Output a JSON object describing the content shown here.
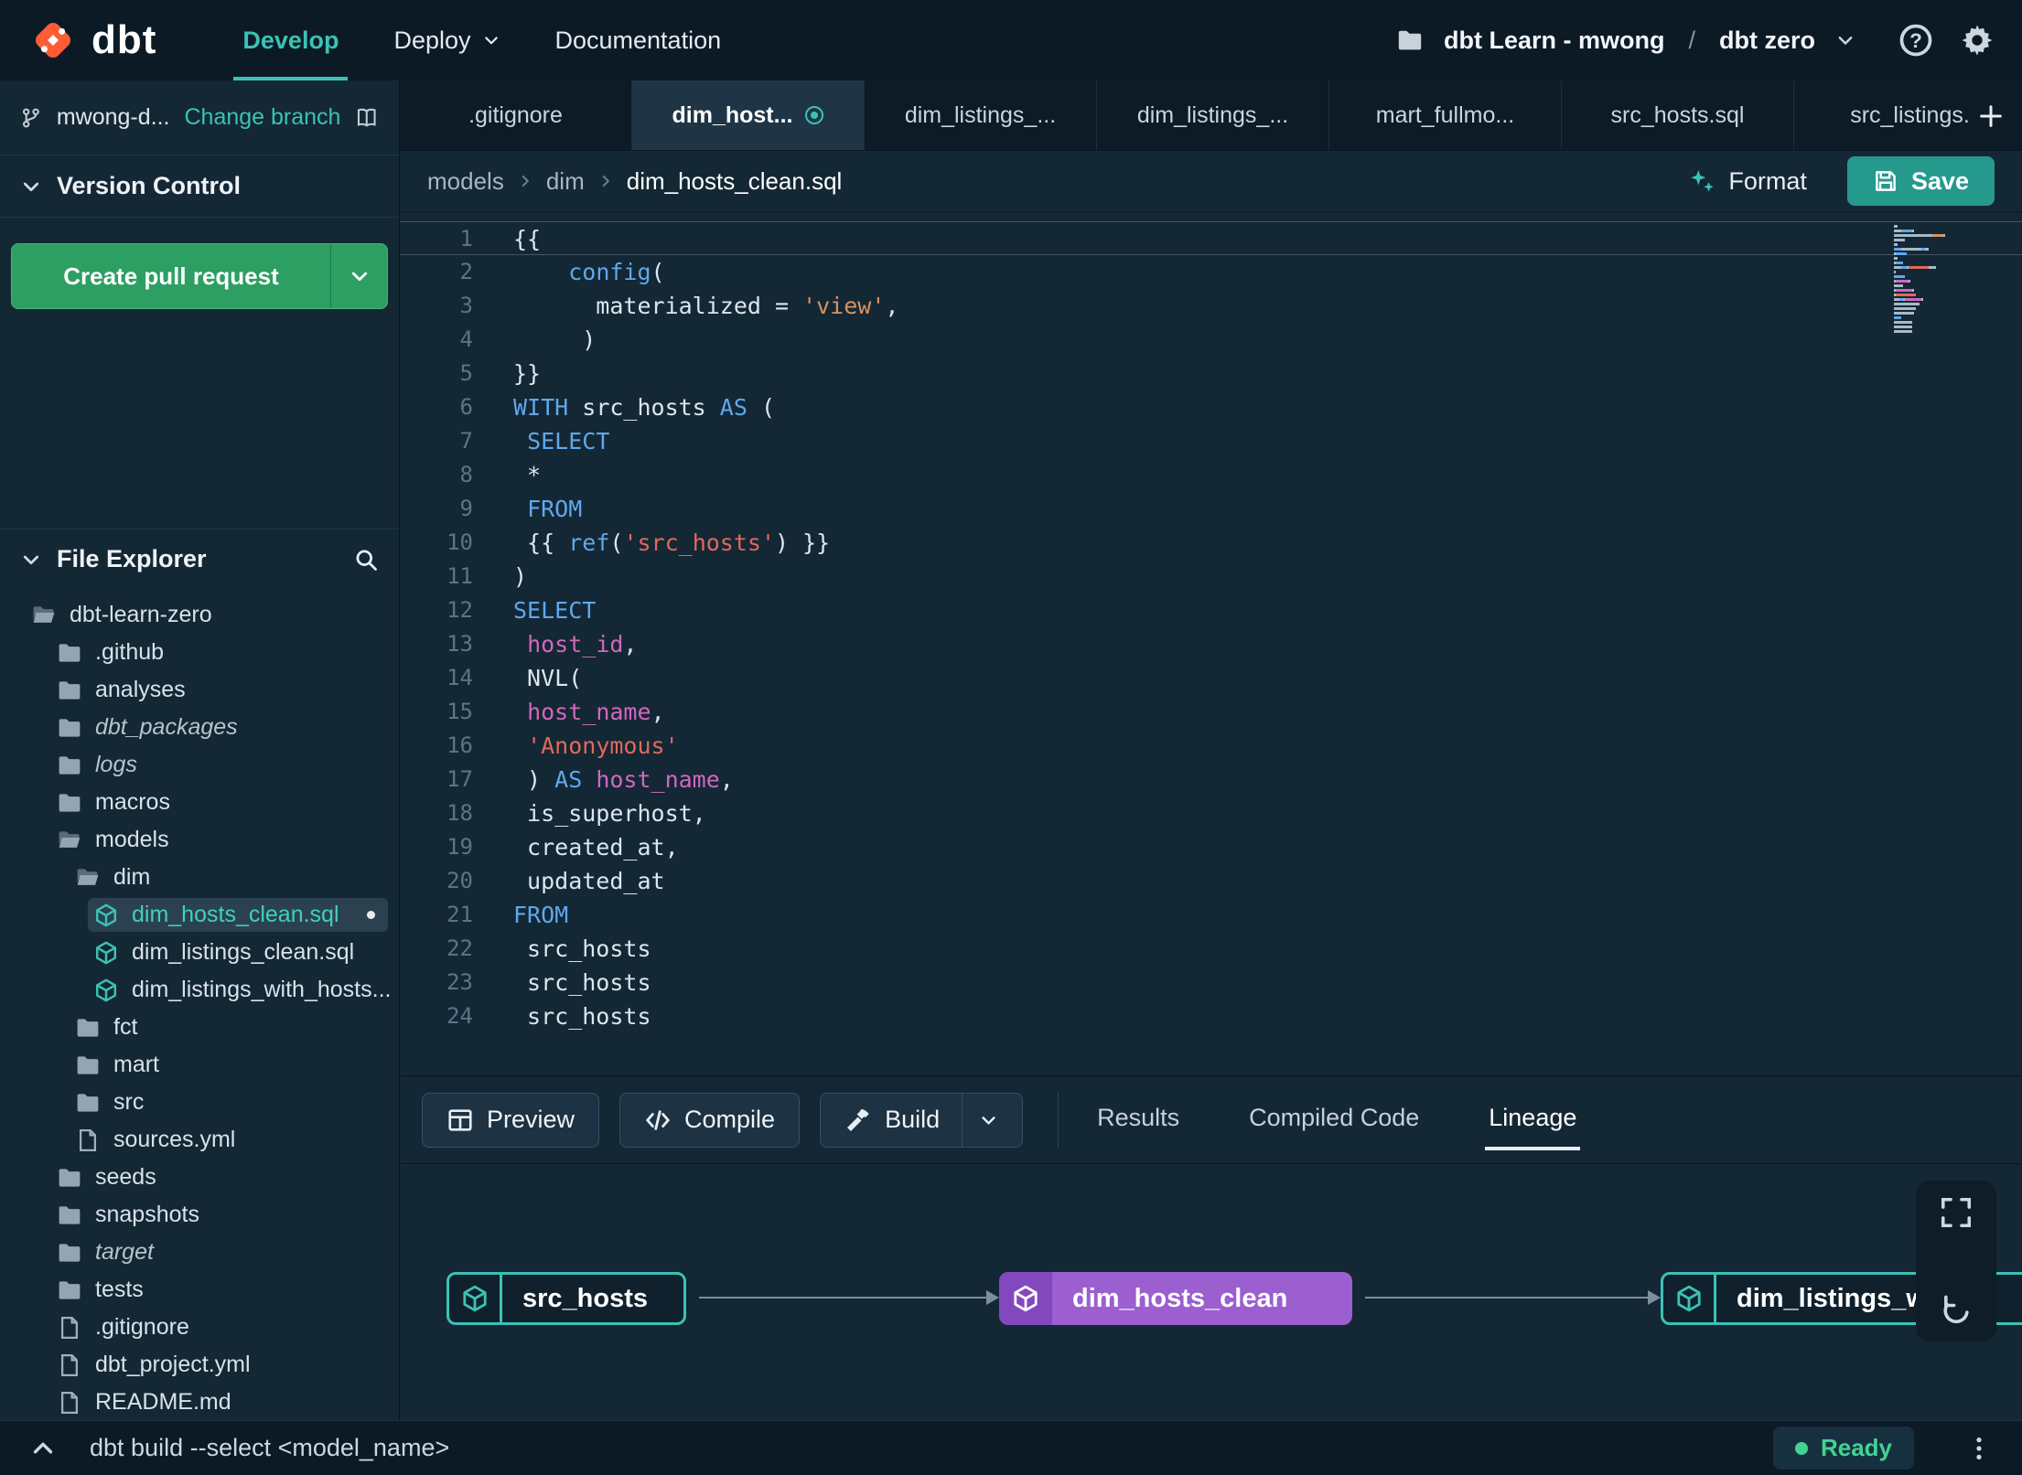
{
  "colors": {
    "accent_teal": "#3bc2b4",
    "brand_orange": "#ff5c35",
    "pr_button_green": "#2d9f63",
    "ready_green": "#42d392",
    "lineage_purple": "#9b5fd0",
    "keyword_blue": "#5fa8ec",
    "identifier_magenta": "#cf68c0",
    "string_orange": "#d79263",
    "string_red": "#e0695c"
  },
  "topnav": {
    "brand": "dbt",
    "items": [
      {
        "label": "Develop",
        "active": true
      },
      {
        "label": "Deploy",
        "caret": true
      },
      {
        "label": "Documentation"
      }
    ],
    "project": {
      "account": "dbt Learn - mwong",
      "separator": "/",
      "name": "dbt zero"
    }
  },
  "sidebar": {
    "branch": {
      "name": "mwong-d...",
      "change_link": "Change branch"
    },
    "version_control": {
      "title": "Version Control",
      "pr_button": "Create pull request"
    },
    "file_explorer": {
      "title": "File Explorer",
      "tree": [
        {
          "label": "dbt-learn-zero",
          "type": "folder-open",
          "depth": 0
        },
        {
          "label": ".github",
          "type": "folder",
          "depth": 1
        },
        {
          "label": "analyses",
          "type": "folder",
          "depth": 1
        },
        {
          "label": "dbt_packages",
          "type": "folder",
          "depth": 1,
          "italic": true
        },
        {
          "label": "logs",
          "type": "folder",
          "depth": 1,
          "italic": true
        },
        {
          "label": "macros",
          "type": "folder",
          "depth": 1
        },
        {
          "label": "models",
          "type": "folder-open",
          "depth": 1
        },
        {
          "label": "dim",
          "type": "folder-open",
          "depth": 2
        },
        {
          "label": "dim_hosts_clean.sql",
          "type": "model",
          "depth": 3,
          "selected": true,
          "modified": true
        },
        {
          "label": "dim_listings_clean.sql",
          "type": "model",
          "depth": 3
        },
        {
          "label": "dim_listings_with_hosts...",
          "type": "model",
          "depth": 3
        },
        {
          "label": "fct",
          "type": "folder",
          "depth": 2
        },
        {
          "label": "mart",
          "type": "folder",
          "depth": 2
        },
        {
          "label": "src",
          "type": "folder",
          "depth": 2
        },
        {
          "label": "sources.yml",
          "type": "file",
          "depth": 2
        },
        {
          "label": "seeds",
          "type": "folder",
          "depth": 1
        },
        {
          "label": "snapshots",
          "type": "folder",
          "depth": 1
        },
        {
          "label": "target",
          "type": "folder",
          "depth": 1,
          "italic": true
        },
        {
          "label": "tests",
          "type": "folder",
          "depth": 1
        },
        {
          "label": ".gitignore",
          "type": "file",
          "depth": 1
        },
        {
          "label": "dbt_project.yml",
          "type": "file",
          "depth": 1
        },
        {
          "label": "README.md",
          "type": "file",
          "depth": 1
        }
      ]
    }
  },
  "editor_tabs": [
    {
      "label": ".gitignore"
    },
    {
      "label": "dim_host...",
      "active": true,
      "modified": true
    },
    {
      "label": "dim_listings_..."
    },
    {
      "label": "dim_listings_..."
    },
    {
      "label": "mart_fullmo..."
    },
    {
      "label": "src_hosts.sql"
    },
    {
      "label": "src_listings."
    }
  ],
  "breadcrumb": {
    "parts": [
      "models",
      "dim",
      "dim_hosts_clean.sql"
    ]
  },
  "toolbar": {
    "format_label": "Format",
    "save_label": "Save"
  },
  "editor": {
    "lines": [
      {
        "n": 1,
        "current": true,
        "tokens": [
          {
            "t": "{{",
            "c": "d"
          }
        ]
      },
      {
        "n": 2,
        "tokens": [
          {
            "t": "    ",
            "c": "d"
          },
          {
            "t": "config",
            "c": "kw"
          },
          {
            "t": "(",
            "c": "d"
          }
        ]
      },
      {
        "n": 3,
        "tokens": [
          {
            "t": "      materialized = ",
            "c": "d"
          },
          {
            "t": "'view'",
            "c": "str"
          },
          {
            "t": ",",
            "c": "d"
          }
        ]
      },
      {
        "n": 4,
        "tokens": [
          {
            "t": "     )",
            "c": "d"
          }
        ]
      },
      {
        "n": 5,
        "tokens": [
          {
            "t": "}}",
            "c": "d"
          }
        ]
      },
      {
        "n": 6,
        "tokens": [
          {
            "t": "WITH",
            "c": "kw"
          },
          {
            "t": " src_hosts ",
            "c": "d"
          },
          {
            "t": "AS",
            "c": "kw"
          },
          {
            "t": " (",
            "c": "d"
          }
        ]
      },
      {
        "n": 7,
        "tokens": [
          {
            "t": " ",
            "c": "d"
          },
          {
            "t": "SELECT",
            "c": "kw"
          }
        ]
      },
      {
        "n": 8,
        "tokens": [
          {
            "t": " *",
            "c": "d"
          }
        ]
      },
      {
        "n": 9,
        "tokens": [
          {
            "t": " ",
            "c": "d"
          },
          {
            "t": "FROM",
            "c": "kw"
          }
        ]
      },
      {
        "n": 10,
        "tokens": [
          {
            "t": " {{ ",
            "c": "d"
          },
          {
            "t": "ref",
            "c": "kw"
          },
          {
            "t": "(",
            "c": "d"
          },
          {
            "t": "'src_hosts'",
            "c": "str2"
          },
          {
            "t": ") }}",
            "c": "d"
          }
        ]
      },
      {
        "n": 11,
        "tokens": [
          {
            "t": ")",
            "c": "d"
          }
        ]
      },
      {
        "n": 12,
        "tokens": [
          {
            "t": "SELECT",
            "c": "kw"
          }
        ]
      },
      {
        "n": 13,
        "tokens": [
          {
            "t": " ",
            "c": "d"
          },
          {
            "t": "host_id",
            "c": "id"
          },
          {
            "t": ",",
            "c": "d"
          }
        ]
      },
      {
        "n": 14,
        "tokens": [
          {
            "t": " NVL(",
            "c": "d"
          }
        ]
      },
      {
        "n": 15,
        "tokens": [
          {
            "t": " ",
            "c": "d"
          },
          {
            "t": "host_name",
            "c": "id"
          },
          {
            "t": ",",
            "c": "d"
          }
        ]
      },
      {
        "n": 16,
        "tokens": [
          {
            "t": " ",
            "c": "d"
          },
          {
            "t": "'Anonymous'",
            "c": "str2"
          }
        ]
      },
      {
        "n": 17,
        "tokens": [
          {
            "t": " ) ",
            "c": "d"
          },
          {
            "t": "AS",
            "c": "kw"
          },
          {
            "t": " ",
            "c": "d"
          },
          {
            "t": "host_name",
            "c": "id"
          },
          {
            "t": ",",
            "c": "d"
          }
        ]
      },
      {
        "n": 18,
        "tokens": [
          {
            "t": " is_superhost,",
            "c": "d"
          }
        ]
      },
      {
        "n": 19,
        "tokens": [
          {
            "t": " created_at,",
            "c": "d"
          }
        ]
      },
      {
        "n": 20,
        "tokens": [
          {
            "t": " updated_at",
            "c": "d"
          }
        ]
      },
      {
        "n": 21,
        "tokens": [
          {
            "t": "FROM",
            "c": "kw"
          }
        ]
      },
      {
        "n": 22,
        "tokens": [
          {
            "t": " src_hosts",
            "c": "d"
          }
        ]
      },
      {
        "n": 23,
        "tokens": [
          {
            "t": " src_hosts",
            "c": "d"
          }
        ]
      },
      {
        "n": 24,
        "tokens": [
          {
            "t": " src_hosts",
            "c": "d"
          }
        ]
      }
    ]
  },
  "bottom_panel": {
    "actions": [
      {
        "label": "Preview",
        "icon": "table-icon"
      },
      {
        "label": "Compile",
        "icon": "code-icon"
      },
      {
        "label": "Build",
        "icon": "hammer-icon",
        "split": true
      }
    ],
    "tabs": [
      {
        "label": "Results"
      },
      {
        "label": "Compiled Code"
      },
      {
        "label": "Lineage",
        "active": true
      }
    ],
    "lineage": {
      "nodes": [
        {
          "label": "src_hosts",
          "style": "teal"
        },
        {
          "label": "dim_hosts_clean",
          "style": "purple"
        },
        {
          "label": "dim_listings_w_h",
          "style": "teal"
        }
      ]
    }
  },
  "command_bar": {
    "command": "dbt build --select <model_name>",
    "status": "Ready"
  }
}
